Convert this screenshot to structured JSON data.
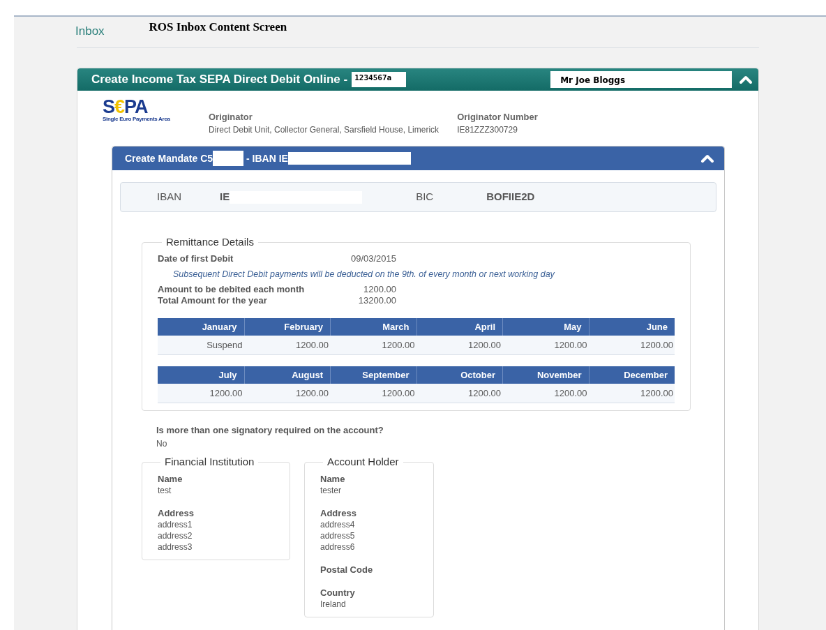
{
  "header": {
    "breadcrumb": "Inbox",
    "title": "ROS Inbox Content Screen"
  },
  "panel": {
    "title": "Create Income Tax SEPA Direct Debit Online -",
    "reference": "1234567a",
    "name": "Mr Joe Bloggs",
    "expanded": true
  },
  "logo": {
    "letters": [
      "S",
      "€",
      "PA"
    ],
    "tagline": "Single Euro Payments Area"
  },
  "originator": {
    "label": "Originator",
    "value": "Direct Debit Unit, Collector General, Sarsfield House, Limerick"
  },
  "originator_number": {
    "label": "Originator Number",
    "value": "IE81ZZZ300729"
  },
  "mandate": {
    "title_start": "Create Mandate C5",
    "title_middle": "- IBAN IE",
    "expanded": true,
    "iban_label": "IBAN",
    "iban_value": "IE",
    "bic_label": "BIC",
    "bic_value": "BOFIIE2D"
  },
  "remittance": {
    "legend": "Remittance Details",
    "items": [
      {
        "kind": "field",
        "label": "Date of first Debit",
        "value": "09/03/2015"
      },
      {
        "kind": "note",
        "text": "Subsequent Direct Debit payments will be deducted on the 9th. of every month or next working day"
      },
      {
        "kind": "field",
        "label": "Amount to be debited each month",
        "value": "1200.00"
      },
      {
        "kind": "field",
        "label": "Total Amount for the year",
        "value": "13200.00"
      }
    ],
    "tables": [
      {
        "columns": [
          "January",
          "February",
          "March",
          "April",
          "May",
          "June"
        ],
        "values": [
          "Suspend",
          "1200.00",
          "1200.00",
          "1200.00",
          "1200.00",
          "1200.00"
        ]
      },
      {
        "columns": [
          "July",
          "August",
          "September",
          "October",
          "November",
          "December"
        ],
        "values": [
          "1200.00",
          "1200.00",
          "1200.00",
          "1200.00",
          "1200.00",
          "1200.00"
        ]
      }
    ]
  },
  "signatory": {
    "question": "Is more than one signatory required on the account?",
    "answer": "No"
  },
  "parties": [
    {
      "legend": "Financial Institution",
      "groups": [
        {
          "label": "Name",
          "lines": [
            "test"
          ]
        },
        {
          "label": "Address",
          "lines": [
            "address1",
            "address2",
            "address3"
          ]
        }
      ]
    },
    {
      "legend": "Account Holder",
      "groups": [
        {
          "label": "Name",
          "lines": [
            "tester"
          ]
        },
        {
          "label": "Address",
          "lines": [
            "address4",
            "address5",
            "address6"
          ]
        },
        {
          "label": "Postal Code"
        },
        {
          "label": "Country",
          "lines": [
            "Ireland"
          ]
        }
      ]
    }
  ]
}
